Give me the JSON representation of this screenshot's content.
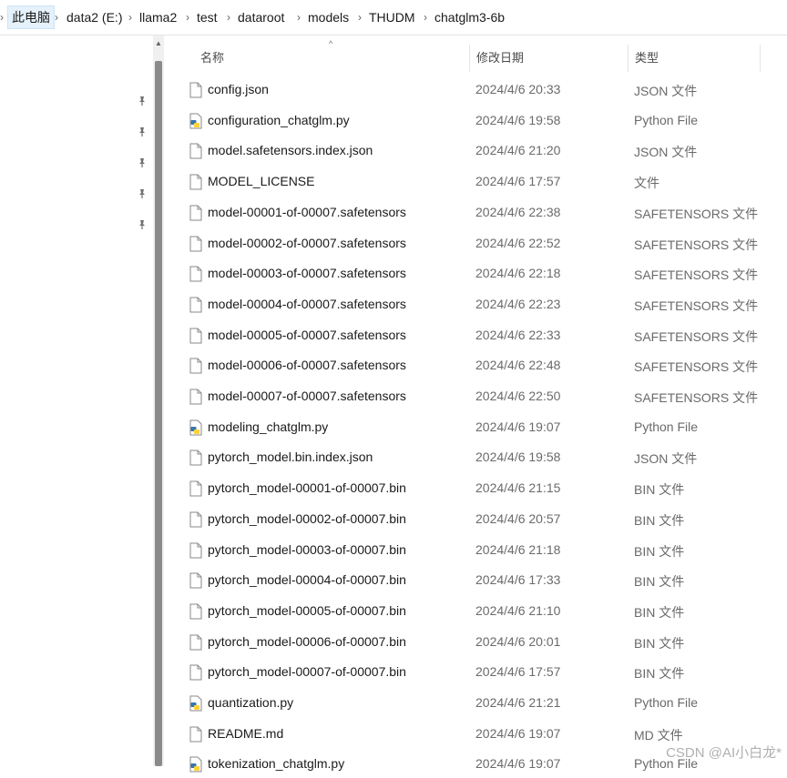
{
  "breadcrumb": {
    "items": [
      "此电脑",
      "data2 (E:)",
      "llama2",
      "test",
      "dataroot",
      "models",
      "THUDM",
      "chatglm3-6b"
    ],
    "separator": "›"
  },
  "columns": {
    "name": "名称",
    "date": "修改日期",
    "type": "类型"
  },
  "files": [
    {
      "name": "config.json",
      "date": "2024/4/6 20:33",
      "type": "JSON 文件",
      "icon": "file-icon"
    },
    {
      "name": "configuration_chatglm.py",
      "date": "2024/4/6 19:58",
      "type": "Python File",
      "icon": "python-file-icon"
    },
    {
      "name": "model.safetensors.index.json",
      "date": "2024/4/6 21:20",
      "type": "JSON 文件",
      "icon": "file-icon"
    },
    {
      "name": "MODEL_LICENSE",
      "date": "2024/4/6 17:57",
      "type": "文件",
      "icon": "file-icon"
    },
    {
      "name": "model-00001-of-00007.safetensors",
      "date": "2024/4/6 22:38",
      "type": "SAFETENSORS 文件",
      "icon": "file-icon"
    },
    {
      "name": "model-00002-of-00007.safetensors",
      "date": "2024/4/6 22:52",
      "type": "SAFETENSORS 文件",
      "icon": "file-icon"
    },
    {
      "name": "model-00003-of-00007.safetensors",
      "date": "2024/4/6 22:18",
      "type": "SAFETENSORS 文件",
      "icon": "file-icon"
    },
    {
      "name": "model-00004-of-00007.safetensors",
      "date": "2024/4/6 22:23",
      "type": "SAFETENSORS 文件",
      "icon": "file-icon"
    },
    {
      "name": "model-00005-of-00007.safetensors",
      "date": "2024/4/6 22:33",
      "type": "SAFETENSORS 文件",
      "icon": "file-icon"
    },
    {
      "name": "model-00006-of-00007.safetensors",
      "date": "2024/4/6 22:48",
      "type": "SAFETENSORS 文件",
      "icon": "file-icon"
    },
    {
      "name": "model-00007-of-00007.safetensors",
      "date": "2024/4/6 22:50",
      "type": "SAFETENSORS 文件",
      "icon": "file-icon"
    },
    {
      "name": "modeling_chatglm.py",
      "date": "2024/4/6 19:07",
      "type": "Python File",
      "icon": "python-file-icon"
    },
    {
      "name": "pytorch_model.bin.index.json",
      "date": "2024/4/6 19:58",
      "type": "JSON 文件",
      "icon": "file-icon"
    },
    {
      "name": "pytorch_model-00001-of-00007.bin",
      "date": "2024/4/6 21:15",
      "type": "BIN 文件",
      "icon": "file-icon"
    },
    {
      "name": "pytorch_model-00002-of-00007.bin",
      "date": "2024/4/6 20:57",
      "type": "BIN 文件",
      "icon": "file-icon"
    },
    {
      "name": "pytorch_model-00003-of-00007.bin",
      "date": "2024/4/6 21:18",
      "type": "BIN 文件",
      "icon": "file-icon"
    },
    {
      "name": "pytorch_model-00004-of-00007.bin",
      "date": "2024/4/6 17:33",
      "type": "BIN 文件",
      "icon": "file-icon"
    },
    {
      "name": "pytorch_model-00005-of-00007.bin",
      "date": "2024/4/6 21:10",
      "type": "BIN 文件",
      "icon": "file-icon"
    },
    {
      "name": "pytorch_model-00006-of-00007.bin",
      "date": "2024/4/6 20:01",
      "type": "BIN 文件",
      "icon": "file-icon"
    },
    {
      "name": "pytorch_model-00007-of-00007.bin",
      "date": "2024/4/6 17:57",
      "type": "BIN 文件",
      "icon": "file-icon"
    },
    {
      "name": "quantization.py",
      "date": "2024/4/6 21:21",
      "type": "Python File",
      "icon": "python-file-icon"
    },
    {
      "name": "README.md",
      "date": "2024/4/6 19:07",
      "type": "MD 文件",
      "icon": "file-icon"
    },
    {
      "name": "tokenization_chatglm.py",
      "date": "2024/4/6 19:07",
      "type": "Python File",
      "icon": "python-file-icon"
    }
  ],
  "nav_pins": 5,
  "watermark": "CSDN @AI小白龙*",
  "colors": {
    "crumb_active_bg": "#e5f1fb",
    "python_blue": "#3776ab",
    "python_yellow": "#ffd43b"
  }
}
